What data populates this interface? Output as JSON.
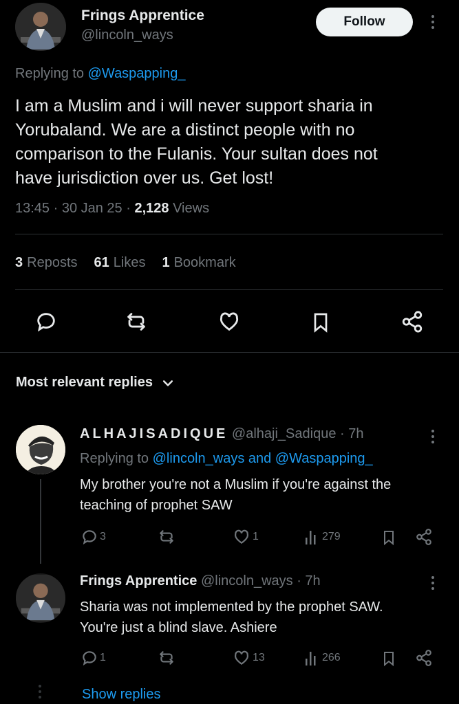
{
  "tweet": {
    "author_name": "Frings Apprentice",
    "author_handle": "@lincoln_ways",
    "follow_label": "Follow",
    "replying_prefix": "Replying to",
    "replying_to": "@Waspapping_",
    "body_lines": [
      "I am a Muslim and i will never support sharia in",
      "Yorubaland. We are a distinct people with no",
      "comparison to the Fulanis. Your sultan does not",
      "have jurisdiction over us. Get lost!"
    ],
    "time": "13:45 · 30 Jan 25 ·",
    "views_count": "2,128",
    "views_label": "Views",
    "reposts_count": "3",
    "reposts_label": "Reposts",
    "likes_count": "61",
    "likes_label": "Likes",
    "bookmarks_count": "1",
    "bookmarks_label": "Bookmark"
  },
  "replies_header": "Most relevant replies",
  "replies": [
    {
      "name": "ALHAJISADIQUE",
      "handle": "@alhaji_Sadique · 7h",
      "replying_prefix": "Replying to",
      "replying_to": "@lincoln_ways and @Waspapping_",
      "body_lines": [
        "My brother you're not a Muslim if you're against the",
        "teaching of prophet SAW"
      ],
      "comments": "3",
      "reposts": "",
      "likes": "1",
      "views": "279"
    },
    {
      "name": "Frings Apprentice",
      "handle": "@lincoln_ways · 7h",
      "body_lines": [
        "Sharia was not implemented by the prophet SAW.",
        "You're just a blind slave. Ashiere"
      ],
      "comments": "1",
      "reposts": "",
      "likes": "13",
      "views": "266"
    }
  ],
  "show_replies": "Show replies",
  "colors": {
    "background": "#000000",
    "text": "#e7e9ea",
    "muted": "#71767b",
    "accent": "#1d9bf0",
    "divider": "#2f3336"
  }
}
